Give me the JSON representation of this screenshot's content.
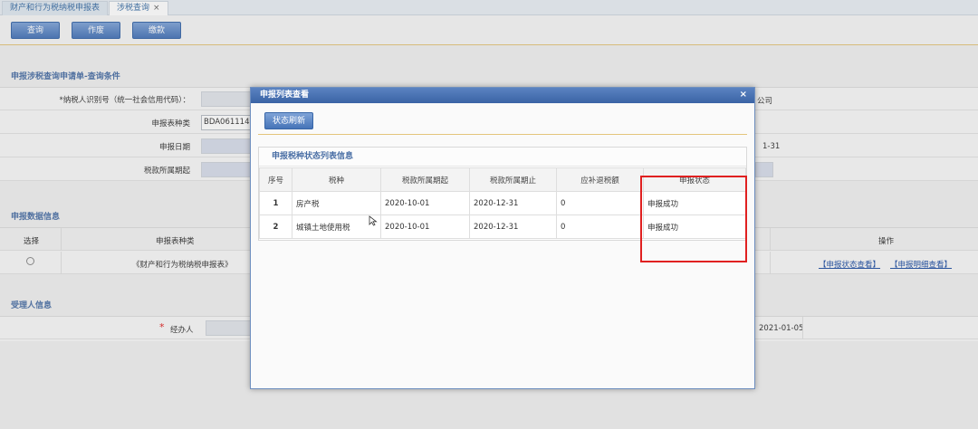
{
  "tabs": [
    {
      "label": "财产和行为税纳税申报表"
    },
    {
      "label": "涉税查询",
      "close": "×"
    }
  ],
  "toolbar": {
    "query": "查询",
    "void": "作废",
    "pay": "缴款"
  },
  "query_section": {
    "title": "申报涉税查询申请单-查询条件",
    "taxpayer_id_label": "*纳税人识别号（统一社会信用代码）：",
    "form_type_label": "申报表种类",
    "form_type_value": "BDA061114E",
    "decl_date_label": "申报日期",
    "period_start_label": "税款所属期起",
    "right_company": "公司",
    "right_date_suffix": "1-31"
  },
  "data_section": {
    "title": "申报数据信息",
    "col_select": "选择",
    "col_type": "申报表种类",
    "col_ops": "操作",
    "row_type": "《财产和行为税纳税申报表》",
    "op_status": "【申报状态查看】",
    "op_detail": "【申报明细查看】"
  },
  "handler_section": {
    "title": "受理人信息",
    "required": "*",
    "agent_label": "经办人",
    "date_value": "2021-01-05"
  },
  "modal": {
    "title": "申报列表查看",
    "close": "×",
    "refresh": "状态刷新",
    "panel_title": "申报税种状态列表信息",
    "headers": [
      "序号",
      "税种",
      "税款所属期起",
      "税款所属期止",
      "应补退税额",
      "申报状态"
    ],
    "rows": [
      {
        "no": "1",
        "tax": "房产税",
        "start": "2020-10-01",
        "end": "2020-12-31",
        "amount": "0",
        "status": "申报成功"
      },
      {
        "no": "2",
        "tax": "城镇土地使用税",
        "start": "2020-10-01",
        "end": "2020-12-31",
        "amount": "0",
        "status": "申报成功"
      }
    ]
  },
  "colors": {
    "accent": "#4674b8",
    "highlight": "#e02020",
    "divider": "#e3c57c"
  }
}
